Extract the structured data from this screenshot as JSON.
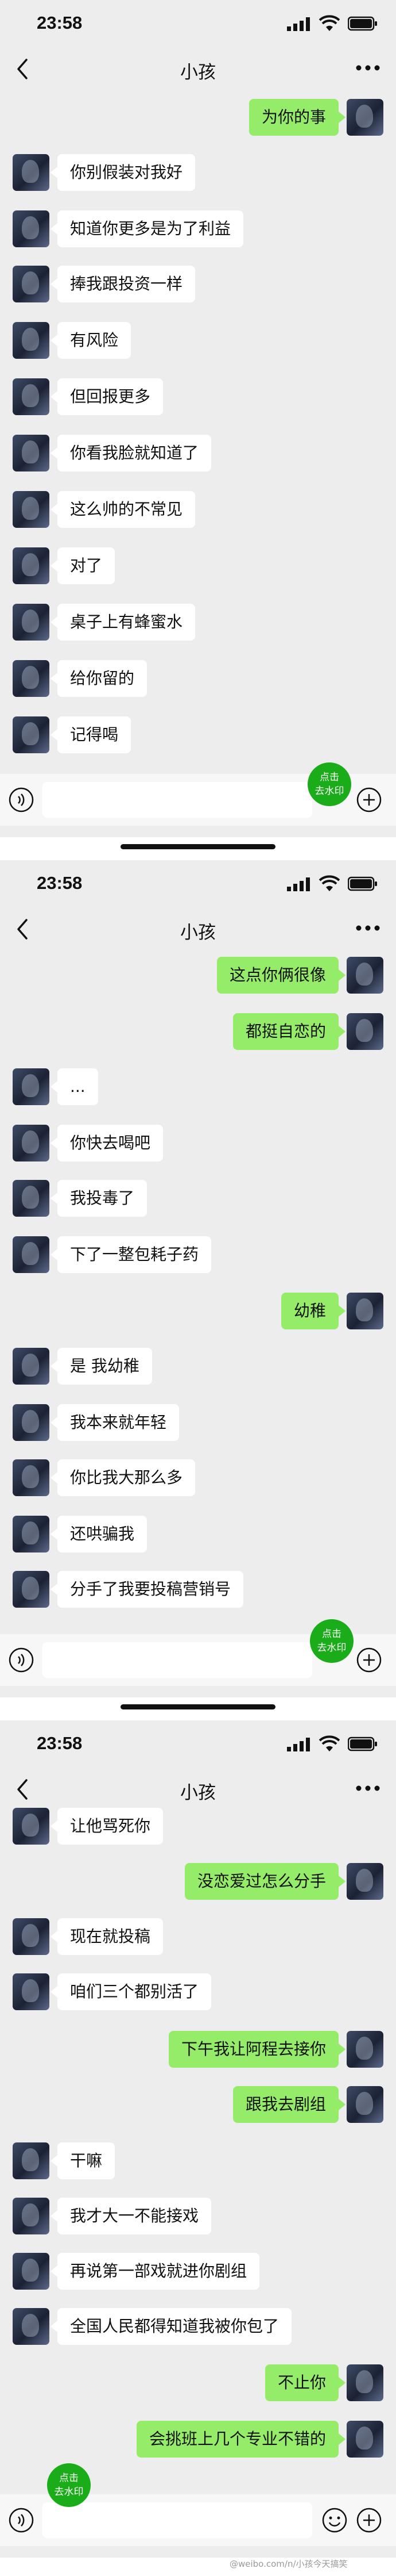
{
  "title": "小孩",
  "status_time": "23:58",
  "watermark": [
    "点击",
    "去水印"
  ],
  "footer": "@weibo.com/n/小孩今天搞笑",
  "panels": [
    {
      "messages": [
        {
          "side": "r",
          "text": "为你的事"
        },
        {
          "side": "l",
          "text": "你别假装对我好"
        },
        {
          "side": "l",
          "text": "知道你更多是为了利益"
        },
        {
          "side": "l",
          "text": "捧我跟投资一样"
        },
        {
          "side": "l",
          "text": "有风险"
        },
        {
          "side": "l",
          "text": "但回报更多"
        },
        {
          "side": "l",
          "text": "你看我脸就知道了"
        },
        {
          "side": "l",
          "text": "这么帅的不常见"
        },
        {
          "side": "l",
          "text": "对了"
        },
        {
          "side": "l",
          "text": "桌子上有蜂蜜水"
        },
        {
          "side": "l",
          "text": "给你留的"
        },
        {
          "side": "l",
          "text": "记得喝"
        }
      ]
    },
    {
      "messages": [
        {
          "side": "r",
          "text": "这点你俩很像"
        },
        {
          "side": "r",
          "text": "都挺自恋的"
        },
        {
          "side": "l",
          "text": "..."
        },
        {
          "side": "l",
          "text": "你快去喝吧"
        },
        {
          "side": "l",
          "text": "我投毒了"
        },
        {
          "side": "l",
          "text": "下了一整包耗子药"
        },
        {
          "side": "r",
          "text": "幼稚"
        },
        {
          "side": "l",
          "text": "是 我幼稚"
        },
        {
          "side": "l",
          "text": "我本来就年轻"
        },
        {
          "side": "l",
          "text": "你比我大那么多"
        },
        {
          "side": "l",
          "text": "还哄骗我"
        },
        {
          "side": "l",
          "text": "分手了我要投稿营销号"
        }
      ]
    },
    {
      "messages": [
        {
          "side": "l",
          "text": "让他骂死你"
        },
        {
          "side": "r",
          "text": "没恋爱过怎么分手"
        },
        {
          "side": "l",
          "text": "现在就投稿"
        },
        {
          "side": "l",
          "text": "咱们三个都别活了"
        },
        {
          "side": "r",
          "text": "下午我让阿程去接你"
        },
        {
          "side": "r",
          "text": "跟我去剧组"
        },
        {
          "side": "l",
          "text": "干嘛"
        },
        {
          "side": "l",
          "text": "我才大一不能接戏"
        },
        {
          "side": "l",
          "text": "再说第一部戏就进你剧组"
        },
        {
          "side": "l",
          "text": "全国人民都得知道我被你包了"
        },
        {
          "side": "r",
          "text": "不止你"
        },
        {
          "side": "r",
          "text": "会挑班上几个专业不错的"
        }
      ]
    }
  ]
}
